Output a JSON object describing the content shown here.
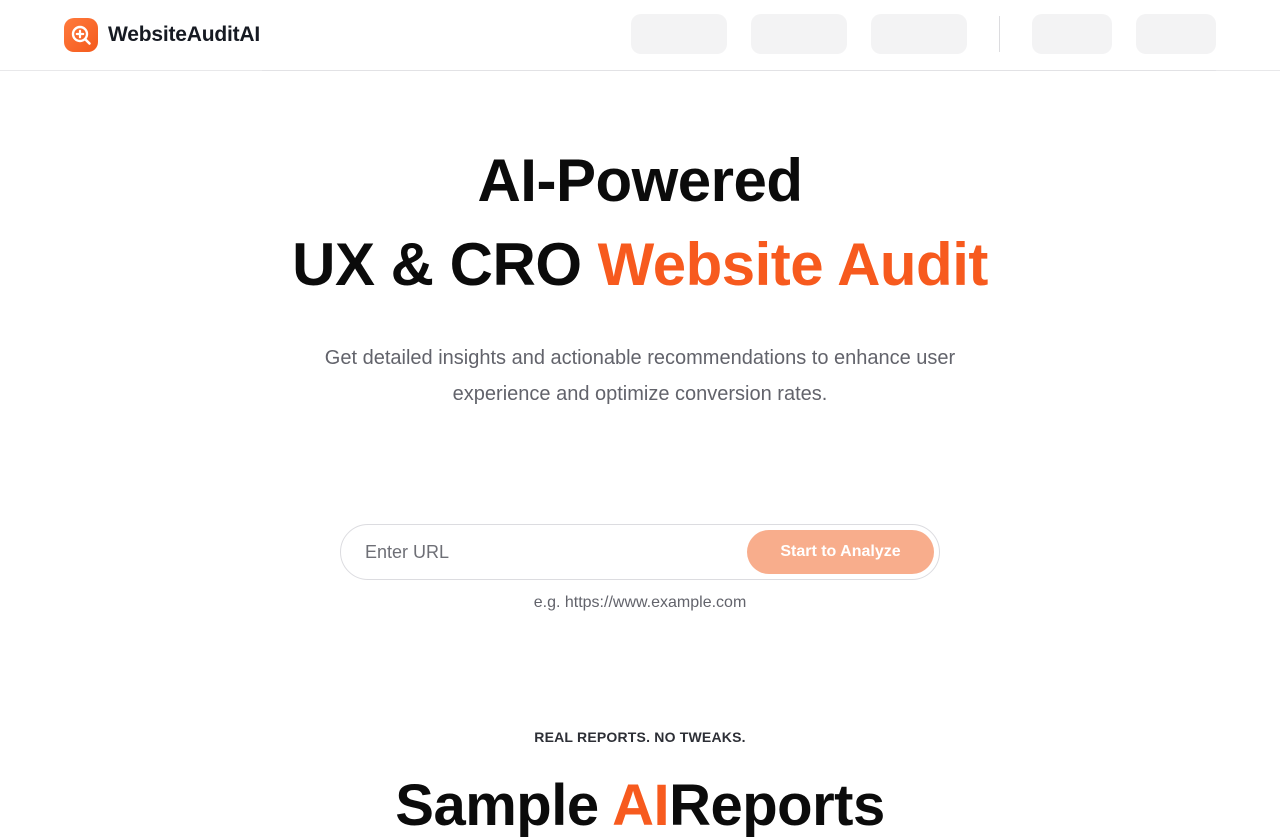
{
  "brand": {
    "name": "WebsiteAuditAI",
    "accent_color": "#f75a1e",
    "logo_icon": "magnify-plus-icon"
  },
  "hero": {
    "line1": "AI-Powered",
    "line2_plain": "UX & CRO",
    "line2_accent": "Website Audit",
    "subtitle": "Get detailed insights and actionable recommendations to enhance user experience and optimize conversion rates."
  },
  "url_form": {
    "placeholder": "Enter URL",
    "value": "",
    "button_label": "Start to Analyze",
    "button_color": "#f8ad8c",
    "example": "e.g. https://www.example.com"
  },
  "samples": {
    "eyebrow": "REAL REPORTS. NO TWEAKS.",
    "title_plain_start": "Sample",
    "title_accent": "AI",
    "title_plain_end": "Reports"
  }
}
